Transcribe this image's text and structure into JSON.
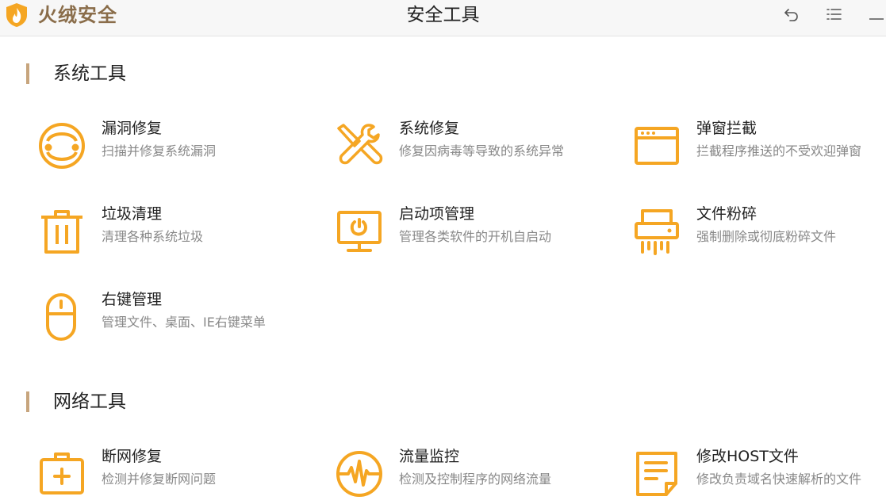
{
  "app": {
    "brand": "火绒安全",
    "window_title": "安全工具"
  },
  "window_controls": {
    "back_icon": "back-arrow-icon",
    "menu_icon": "menu-icon",
    "minimize_icon": "minimize-icon"
  },
  "accent_color": "#f5a623",
  "sections": [
    {
      "title": "系统工具",
      "tools": [
        {
          "name": "漏洞修复",
          "desc": "扫描并修复系统漏洞",
          "icon": "vulnerability-repair-icon"
        },
        {
          "name": "系统修复",
          "desc": "修复因病毒等导致的系统异常",
          "icon": "wrench-screwdriver-icon"
        },
        {
          "name": "弹窗拦截",
          "desc": "拦截程序推送的不受欢迎弹窗",
          "icon": "popup-window-icon"
        },
        {
          "name": "垃圾清理",
          "desc": "清理各种系统垃圾",
          "icon": "trash-can-icon"
        },
        {
          "name": "启动项管理",
          "desc": "管理各类软件的开机自启动",
          "icon": "monitor-power-icon"
        },
        {
          "name": "文件粉碎",
          "desc": "强制删除或彻底粉碎文件",
          "icon": "shredder-icon"
        },
        {
          "name": "右键管理",
          "desc": "管理文件、桌面、IE右键菜单",
          "icon": "mouse-icon"
        }
      ]
    },
    {
      "title": "网络工具",
      "tools": [
        {
          "name": "断网修复",
          "desc": "检测并修复断网问题",
          "icon": "first-aid-kit-icon"
        },
        {
          "name": "流量监控",
          "desc": "检测及控制程序的网络流量",
          "icon": "pulse-monitor-icon"
        },
        {
          "name": "修改HOST文件",
          "desc": "修改负责域名快速解析的文件",
          "icon": "host-file-icon"
        }
      ]
    }
  ]
}
